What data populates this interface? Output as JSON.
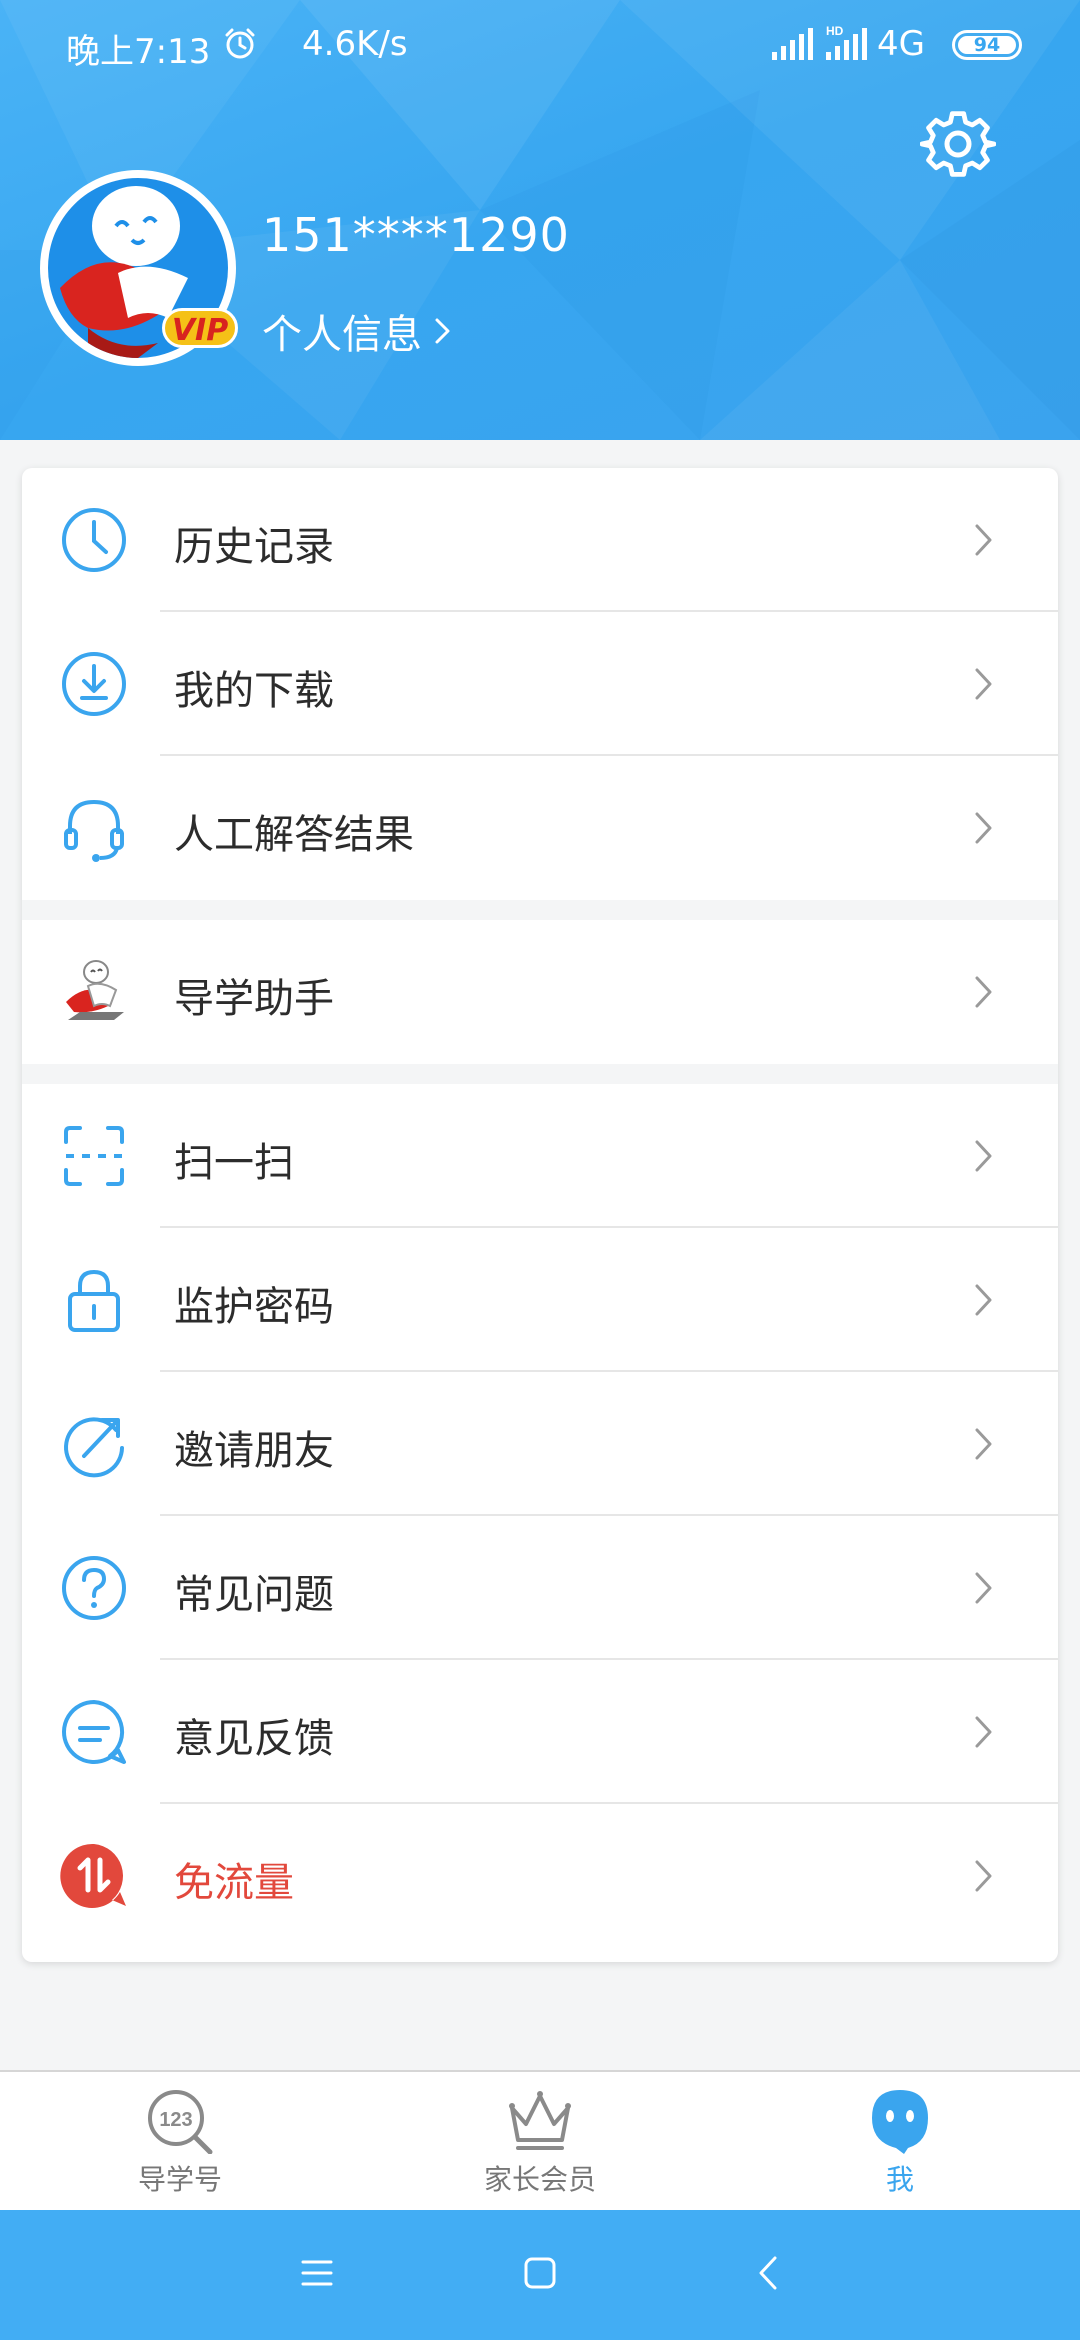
{
  "status_bar": {
    "time": "晚上7:13",
    "net_speed": "4.6K/s",
    "network": "4G",
    "hd_label": "HD",
    "battery": "94"
  },
  "profile": {
    "phone": "151****1290",
    "info_link": "个人信息",
    "vip_badge": "VIP"
  },
  "menu_groups": [
    [
      {
        "name": "history",
        "label": "历史记录",
        "icon": "clock-icon"
      },
      {
        "name": "downloads",
        "label": "我的下载",
        "icon": "download-icon"
      },
      {
        "name": "manual-answers",
        "label": "人工解答结果",
        "icon": "headset-icon"
      }
    ],
    [
      {
        "name": "study-assistant",
        "label": "导学助手",
        "icon": "mascot-icon"
      }
    ],
    [
      {
        "name": "scan",
        "label": "扫一扫",
        "icon": "scan-icon"
      },
      {
        "name": "parental-password",
        "label": "监护密码",
        "icon": "lock-icon"
      },
      {
        "name": "invite-friends",
        "label": "邀请朋友",
        "icon": "share-icon"
      },
      {
        "name": "faq",
        "label": "常见问题",
        "icon": "question-icon"
      },
      {
        "name": "feedback",
        "label": "意见反馈",
        "icon": "chat-icon"
      },
      {
        "name": "free-data",
        "label": "免流量",
        "icon": "data-transfer-icon",
        "color": "#e2483c"
      }
    ]
  ],
  "tabs": [
    {
      "name": "study-number",
      "label": "导学号",
      "icon": "magnifier-123-icon",
      "active": false
    },
    {
      "name": "parent-vip",
      "label": "家长会员",
      "icon": "crown-icon",
      "active": false
    },
    {
      "name": "me",
      "label": "我",
      "icon": "face-icon",
      "active": true
    }
  ],
  "colors": {
    "brand_blue": "#3aa5ee",
    "accent_red": "#e2483c",
    "navbar": "#42adf4"
  }
}
